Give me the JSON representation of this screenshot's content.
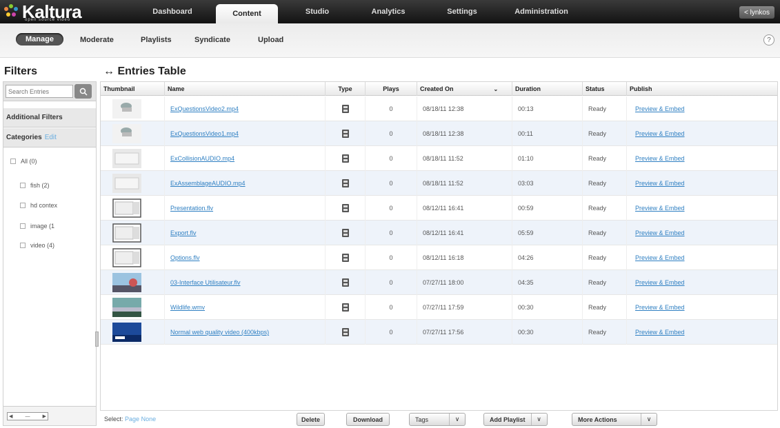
{
  "app": {
    "logo": "Kaltura",
    "logo_sub": "open source video",
    "user_label": "< lynkos"
  },
  "top_nav": [
    {
      "label": "Dashboard"
    },
    {
      "label": "Content"
    },
    {
      "label": "Studio"
    },
    {
      "label": "Analytics"
    },
    {
      "label": "Settings"
    },
    {
      "label": "Administration"
    }
  ],
  "sub_nav": [
    {
      "label": "Manage"
    },
    {
      "label": "Moderate"
    },
    {
      "label": "Playlists"
    },
    {
      "label": "Syndicate"
    },
    {
      "label": "Upload"
    }
  ],
  "help": "?",
  "filters": {
    "title": "Filters",
    "search_placeholder": "Search Entries",
    "additional_filters": "Additional Filters",
    "categories_label": "Categories",
    "categories_edit": "Edit",
    "categories": [
      {
        "label": "All (0)"
      },
      {
        "label": "fish (2)"
      },
      {
        "label": "hd contex"
      },
      {
        "label": "image (1"
      },
      {
        "label": "video (4)"
      }
    ]
  },
  "table": {
    "title": "↔ Entries Table",
    "columns": [
      "Thumbnail",
      "Name",
      "Type",
      "Plays",
      "Created On",
      "Duration",
      "Status",
      "Publish"
    ],
    "sort_indicator": "⌄",
    "rows": [
      {
        "name": "ExQuestionsVideo2.mp4",
        "plays": "0",
        "created": "08/18/11 12:38",
        "duration": "00:13",
        "status": "Ready",
        "publish": "Preview & Embed",
        "thumb": "gray-clip"
      },
      {
        "name": "ExQuestionsVideo1.mp4",
        "plays": "0",
        "created": "08/18/11 12:38",
        "duration": "00:11",
        "status": "Ready",
        "publish": "Preview & Embed",
        "thumb": "gray-clip"
      },
      {
        "name": "ExCollisionAUDIO.mp4",
        "plays": "0",
        "created": "08/18/11 11:52",
        "duration": "01:10",
        "status": "Ready",
        "publish": "Preview & Embed",
        "thumb": "light"
      },
      {
        "name": "ExAssemblageAUDIO.mp4",
        "plays": "0",
        "created": "08/18/11 11:52",
        "duration": "03:03",
        "status": "Ready",
        "publish": "Preview & Embed",
        "thumb": "light"
      },
      {
        "name": "Presentation.flv",
        "plays": "0",
        "created": "08/12/11 16:41",
        "duration": "00:59",
        "status": "Ready",
        "publish": "Preview & Embed",
        "thumb": "window"
      },
      {
        "name": "Export.flv",
        "plays": "0",
        "created": "08/12/11 16:41",
        "duration": "05:59",
        "status": "Ready",
        "publish": "Preview & Embed",
        "thumb": "window"
      },
      {
        "name": "Options.flv",
        "plays": "0",
        "created": "08/12/11 16:18",
        "duration": "04:26",
        "status": "Ready",
        "publish": "Preview & Embed",
        "thumb": "window"
      },
      {
        "name": "03-Interface Utilisateur.flv",
        "plays": "0",
        "created": "07/27/11 18:00",
        "duration": "04:35",
        "status": "Ready",
        "publish": "Preview & Embed",
        "thumb": "sky"
      },
      {
        "name": "Wildlife.wmv",
        "plays": "0",
        "created": "07/27/11 17:59",
        "duration": "00:30",
        "status": "Ready",
        "publish": "Preview & Embed",
        "thumb": "landscape"
      },
      {
        "name": "Normal web quality video (400kbps)",
        "plays": "0",
        "created": "07/27/11 17:56",
        "duration": "00:30",
        "status": "Ready",
        "publish": "Preview & Embed",
        "thumb": "blue"
      }
    ]
  },
  "footer": {
    "select_label": "Select:",
    "select_page": "Page",
    "select_none": "None",
    "delete": "Delete",
    "download": "Download",
    "tags": "Tags",
    "add_playlist": "Add Playlist",
    "more_actions": "More Actions",
    "dropdown_arrow": "∨"
  }
}
